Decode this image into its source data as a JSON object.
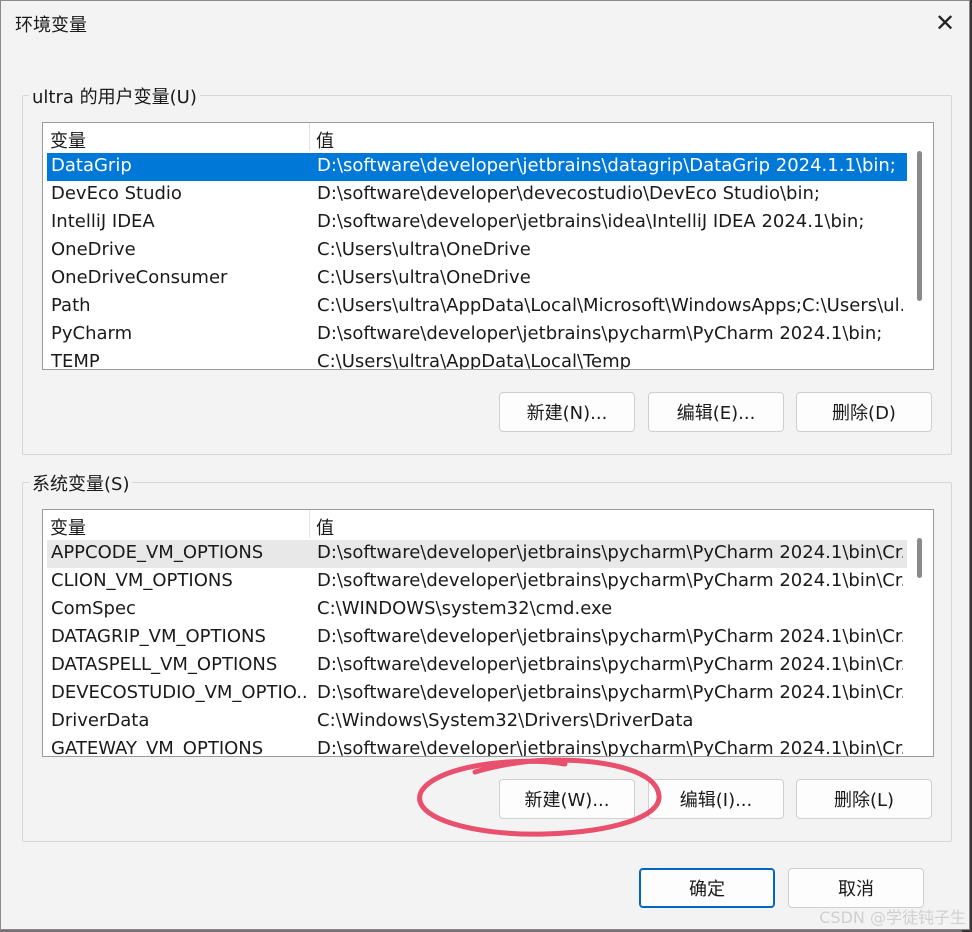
{
  "window": {
    "title": "环境变量",
    "close_icon": "✕"
  },
  "user_vars": {
    "group_label": "ultra 的用户变量(U)",
    "headers": {
      "name": "变量",
      "value": "值"
    },
    "rows": [
      {
        "name": "DataGrip",
        "value": "D:\\software\\developer\\jetbrains\\datagrip\\DataGrip 2024.1.1\\bin;"
      },
      {
        "name": "DevEco Studio",
        "value": "D:\\software\\developer\\devecostudio\\DevEco Studio\\bin;"
      },
      {
        "name": "IntelliJ IDEA",
        "value": "D:\\software\\developer\\jetbrains\\idea\\IntelliJ IDEA 2024.1\\bin;"
      },
      {
        "name": "OneDrive",
        "value": "C:\\Users\\ultra\\OneDrive"
      },
      {
        "name": "OneDriveConsumer",
        "value": "C:\\Users\\ultra\\OneDrive"
      },
      {
        "name": "Path",
        "value": "C:\\Users\\ultra\\AppData\\Local\\Microsoft\\WindowsApps;C:\\Users\\ul..."
      },
      {
        "name": "PyCharm",
        "value": "D:\\software\\developer\\jetbrains\\pycharm\\PyCharm 2024.1\\bin;"
      },
      {
        "name": "TEMP",
        "value": "C:\\Users\\ultra\\AppData\\Local\\Temp"
      }
    ],
    "buttons": {
      "new": "新建(N)...",
      "edit": "编辑(E)...",
      "delete": "删除(D)"
    }
  },
  "system_vars": {
    "group_label": "系统变量(S)",
    "headers": {
      "name": "变量",
      "value": "值"
    },
    "rows": [
      {
        "name": "APPCODE_VM_OPTIONS",
        "value": "D:\\software\\developer\\jetbrains\\pycharm\\PyCharm 2024.1\\bin\\Cr..."
      },
      {
        "name": "CLION_VM_OPTIONS",
        "value": "D:\\software\\developer\\jetbrains\\pycharm\\PyCharm 2024.1\\bin\\Cr..."
      },
      {
        "name": "ComSpec",
        "value": "C:\\WINDOWS\\system32\\cmd.exe"
      },
      {
        "name": "DATAGRIP_VM_OPTIONS",
        "value": "D:\\software\\developer\\jetbrains\\pycharm\\PyCharm 2024.1\\bin\\Cr..."
      },
      {
        "name": "DATASPELL_VM_OPTIONS",
        "value": "D:\\software\\developer\\jetbrains\\pycharm\\PyCharm 2024.1\\bin\\Cr..."
      },
      {
        "name": "DEVECOSTUDIO_VM_OPTIO...",
        "value": "D:\\software\\developer\\jetbrains\\pycharm\\PyCharm 2024.1\\bin\\Cr..."
      },
      {
        "name": "DriverData",
        "value": "C:\\Windows\\System32\\Drivers\\DriverData"
      },
      {
        "name": "GATEWAY_VM_OPTIONS",
        "value": "D:\\software\\developer\\jetbrains\\pycharm\\PyCharm 2024.1\\bin\\Cr..."
      }
    ],
    "buttons": {
      "new": "新建(W)...",
      "edit": "编辑(I)...",
      "delete": "删除(L)"
    }
  },
  "footer": {
    "ok": "确定",
    "cancel": "取消"
  },
  "watermark": "CSDN @学徒钝子生",
  "colors": {
    "selection": "#0078d7",
    "annotation": "#e8506e"
  }
}
